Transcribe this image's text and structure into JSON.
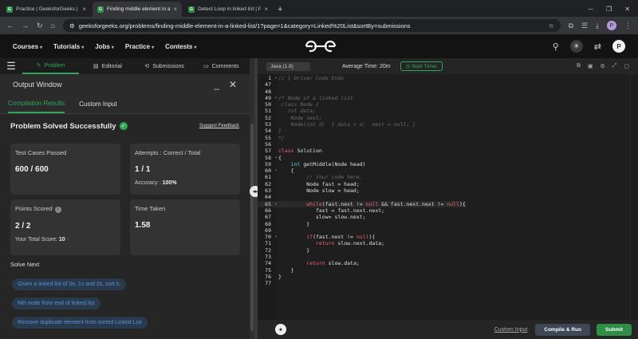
{
  "browser": {
    "tabs": [
      {
        "title": "Practice | GeeksforGeeks | A co",
        "active": false
      },
      {
        "title": "Finding middle element in a link",
        "active": true
      },
      {
        "title": "Detect Loop in linked list | Prac",
        "active": false
      }
    ],
    "new_tab": "+",
    "url": "geeksforgeeks.org/problems/finding-middle-element-in-a-linked-list/1?page=1&category=Linked%20List&sortBy=submissions",
    "profile_initial": "P"
  },
  "site": {
    "nav": [
      "Courses",
      "Tutorials",
      "Jobs",
      "Practice",
      "Contests"
    ],
    "logo": "GfG",
    "user_initial": "P"
  },
  "subtabs": {
    "problem": "Problem",
    "editorial": "Editorial",
    "submissions": "Submissions",
    "comments": "Comments"
  },
  "output": {
    "title": "Output Window",
    "tabs": [
      "Compilation Results",
      "Custom Input"
    ],
    "status": "Problem Solved Successfully",
    "suggest": "Suggest Feedback",
    "cards": {
      "tests_label": "Test Cases Passed",
      "tests_value": "600 / 600",
      "attempts_label": "Attempts : Correct / Total",
      "attempts_value": "1 / 1",
      "accuracy_label": "Accuracy :",
      "accuracy_value": "100%",
      "points_label": "Points Scored",
      "points_value": "2 / 2",
      "total_label": "Your Total Score:",
      "total_value": "10",
      "time_label": "Time Taken",
      "time_value": "1.58"
    },
    "solve_next": "Solve Next",
    "suggestions": [
      "Given a linked list of 0s, 1s and 2s, sort it.",
      "Nth node from end of linked list",
      "Remove duplicate element from sorted Linked List"
    ]
  },
  "editor": {
    "language": "Java (1.8)",
    "avg_time": "Average Time: 20m",
    "timer": "Start Timer",
    "custom_input": "Custom Input",
    "compile_run": "Compile & Run",
    "submit": "Submit",
    "lines": [
      {
        "n": "1",
        "t": "// } Driver Code Ends",
        "k": "cm",
        "f": "▸"
      },
      {
        "n": "47",
        "t": "",
        "k": ""
      },
      {
        "n": "48",
        "t": "",
        "k": ""
      },
      {
        "n": "49",
        "t": "/* Node of a linked list",
        "k": "cm",
        "f": "▾"
      },
      {
        "n": "50",
        "t": " class Node {",
        "k": "cm"
      },
      {
        "n": "51",
        "t": "   int data;",
        "k": "cm"
      },
      {
        "n": "52",
        "t": "    Node next;",
        "k": "cm"
      },
      {
        "n": "53",
        "t": "    Node(int d)  { data = d;  next = null; }",
        "k": "cm"
      },
      {
        "n": "54",
        "t": "}",
        "k": "cm"
      },
      {
        "n": "55",
        "t": "*/",
        "k": "cm"
      },
      {
        "n": "56",
        "t": "",
        "k": ""
      },
      {
        "n": "57",
        "t": "class Solution",
        "k": "cls"
      },
      {
        "n": "58",
        "t": "{",
        "k": "",
        "f": "▾"
      },
      {
        "n": "59",
        "t": "    int getMiddle(Node head)",
        "k": "fn"
      },
      {
        "n": "60",
        "t": "    {",
        "k": "",
        "f": "▾"
      },
      {
        "n": "61",
        "t": "         // Your code here.",
        "k": "cm"
      },
      {
        "n": "62",
        "t": "         Node fast = head;",
        "k": ""
      },
      {
        "n": "63",
        "t": "         Node slow = head;",
        "k": ""
      },
      {
        "n": "64",
        "t": "",
        "k": ""
      },
      {
        "n": "65",
        "t": "         while(fast.next != null && fast.next.next != null){",
        "k": "while",
        "f": "▾",
        "hl": true
      },
      {
        "n": "66",
        "t": "            fast = fast.next.next;",
        "k": ""
      },
      {
        "n": "67",
        "t": "            slow= slow.next;",
        "k": ""
      },
      {
        "n": "68",
        "t": "         }",
        "k": ""
      },
      {
        "n": "69",
        "t": "",
        "k": ""
      },
      {
        "n": "70",
        "t": "         if(fast.next != null){",
        "k": "if",
        "f": "▾"
      },
      {
        "n": "71",
        "t": "            return slow.next.data;",
        "k": "ret"
      },
      {
        "n": "72",
        "t": "         }",
        "k": ""
      },
      {
        "n": "73",
        "t": "",
        "k": ""
      },
      {
        "n": "74",
        "t": "         return slow.data;",
        "k": "ret"
      },
      {
        "n": "75",
        "t": "    }",
        "k": ""
      },
      {
        "n": "76",
        "t": "}",
        "k": ""
      },
      {
        "n": "77",
        "t": "",
        "k": ""
      }
    ]
  }
}
